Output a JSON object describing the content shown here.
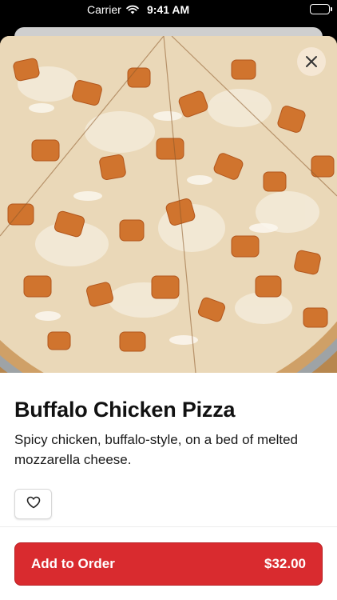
{
  "status_bar": {
    "carrier": "Carrier",
    "time": "9:41 AM"
  },
  "item": {
    "name": "Buffalo Chicken Pizza",
    "description": "Spicy chicken, buffalo-style, on a bed of melted mozzarella cheese."
  },
  "actions": {
    "add_to_order_label": "Add to Order",
    "price": "$32.00"
  },
  "icons": {
    "close": "close-icon",
    "favorite": "heart-icon",
    "wifi": "wifi-icon",
    "battery": "battery-icon"
  },
  "colors": {
    "accent": "#d92b2f",
    "text": "#111111",
    "background": "#ffffff"
  }
}
